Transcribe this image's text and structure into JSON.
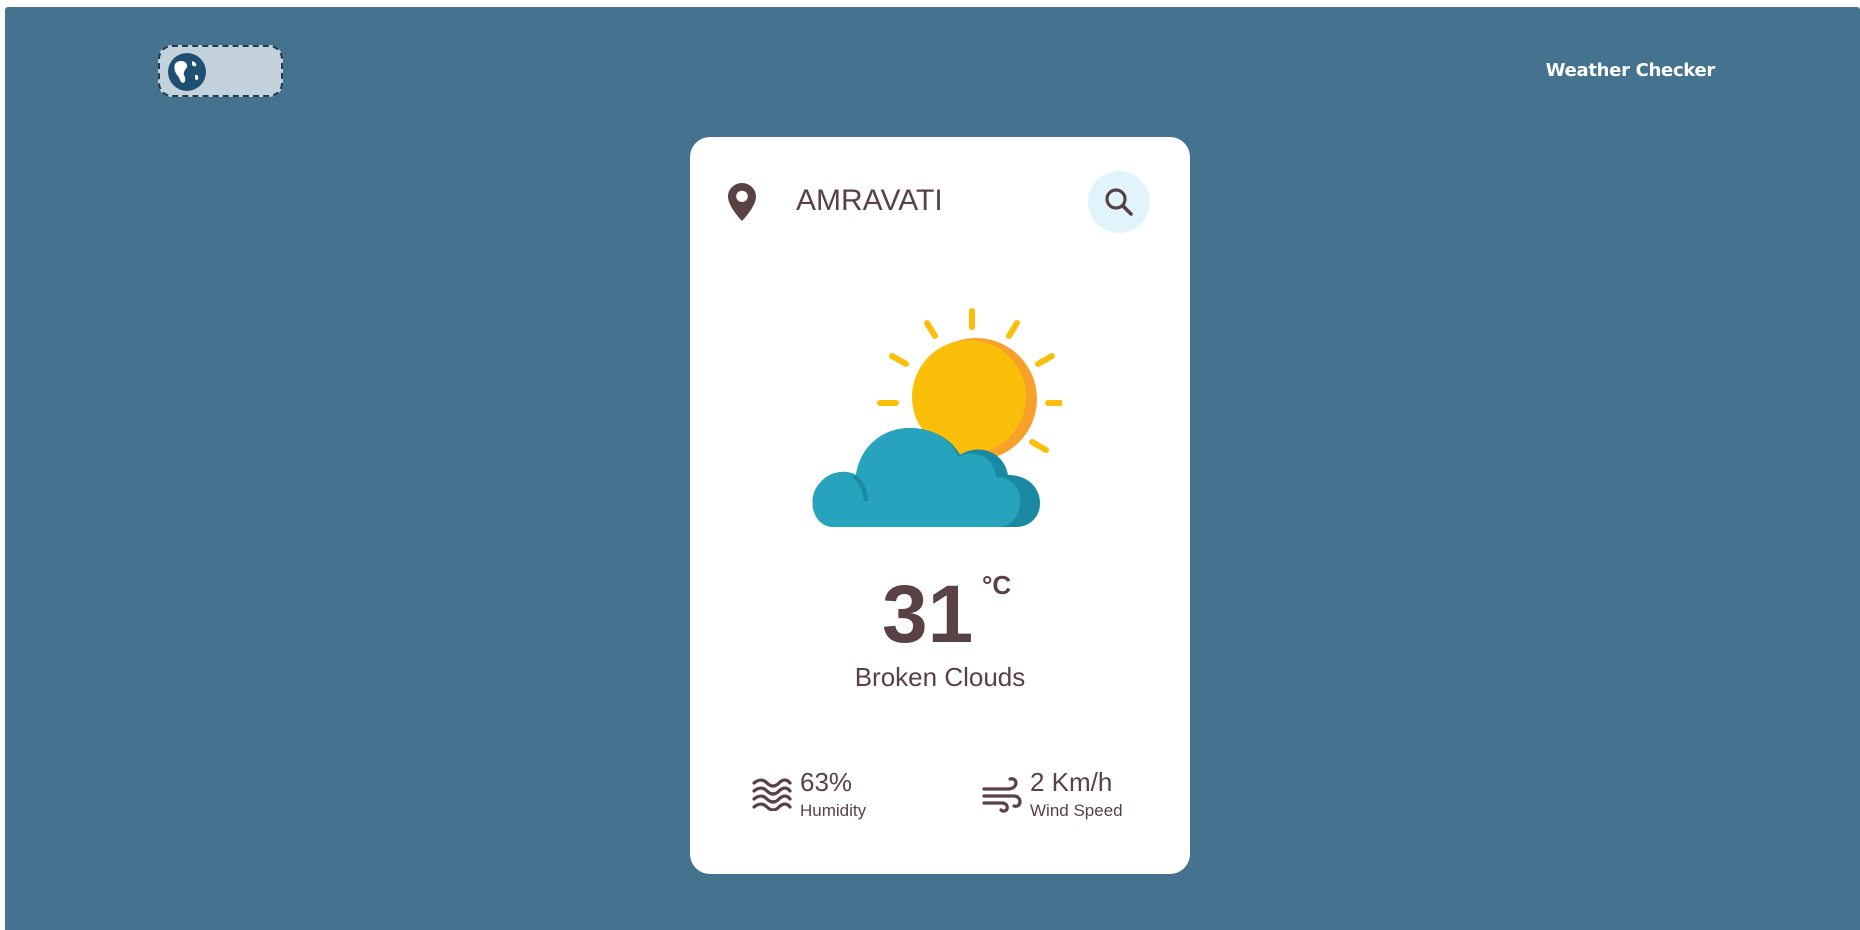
{
  "header": {
    "logo_icon": "globe-icon",
    "title": "Weather Checker"
  },
  "search": {
    "location_icon": "map-pin-icon",
    "value": "AMRAVATI",
    "button_icon": "search-icon"
  },
  "weather": {
    "icon": "sun-behind-cloud-icon",
    "temperature": "31",
    "unit": "°C",
    "description": "Broken Clouds"
  },
  "details": {
    "humidity": {
      "icon": "waves-icon",
      "value": "63%",
      "label": "Humidity"
    },
    "wind": {
      "icon": "wind-icon",
      "value": "2 Km/h",
      "label": "Wind Speed"
    }
  },
  "colors": {
    "background": "#44728f",
    "card": "#ffffff",
    "text": "#5a4143",
    "search_button": "#e1f4fb",
    "sun": "#fbbf0a",
    "sun_shade": "#f7a12b",
    "cloud": "#28a3bd",
    "cloud_shade": "#1a8aa3"
  }
}
